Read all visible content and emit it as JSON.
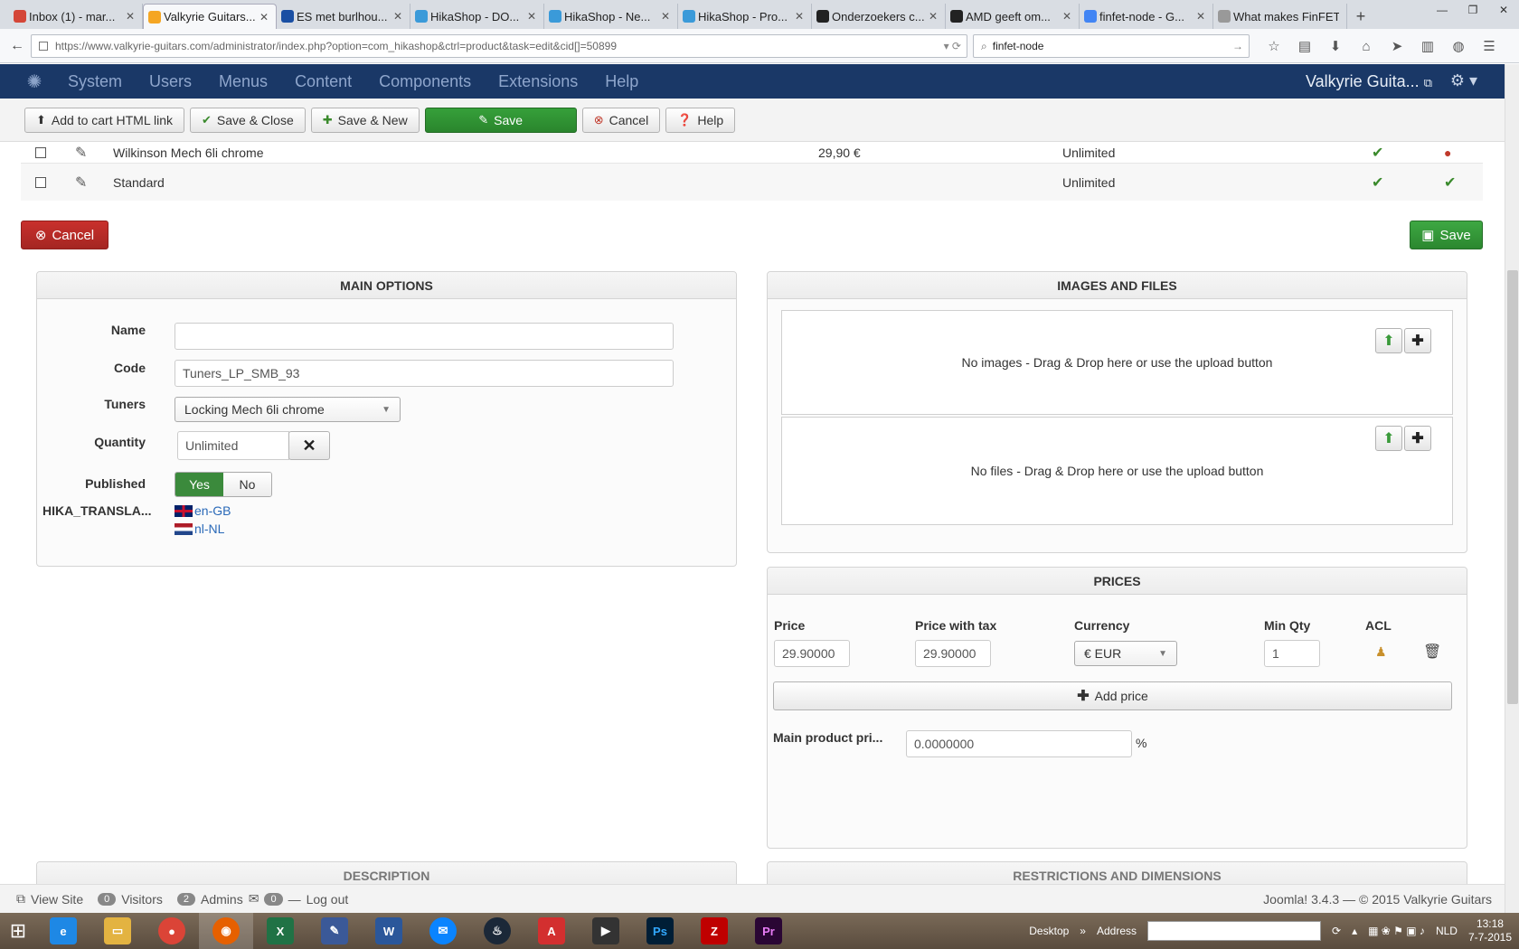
{
  "browser": {
    "tabs": [
      {
        "label": "Inbox (1) - mar...",
        "color": "#d44638",
        "active": false
      },
      {
        "label": "Valkyrie Guitars...",
        "color": "#f5a623",
        "active": true
      },
      {
        "label": "ES met burlhou...",
        "color": "#1a4fa3",
        "active": false
      },
      {
        "label": "HikaShop - DO...",
        "color": "#3a9ad9",
        "active": false
      },
      {
        "label": "HikaShop - Ne...",
        "color": "#3a9ad9",
        "active": false
      },
      {
        "label": "HikaShop - Pro...",
        "color": "#3a9ad9",
        "active": false
      },
      {
        "label": "Onderzoekers c...",
        "color": "#222222",
        "active": false
      },
      {
        "label": "AMD geeft om...",
        "color": "#222222",
        "active": false
      },
      {
        "label": "finfet-node - G...",
        "color": "#4285f4",
        "active": false
      },
      {
        "label": "What makes FinFET...",
        "color": "#999999",
        "active": false
      }
    ],
    "url": "https://www.valkyrie-guitars.com/administrator/index.php?option=com_hikashop&ctrl=product&task=edit&cid[]=50899",
    "search": "finfet-node"
  },
  "joomla": {
    "menu": [
      "System",
      "Users",
      "Menus",
      "Content",
      "Components",
      "Extensions",
      "Help"
    ],
    "site_name": "Valkyrie Guita..."
  },
  "toolbar": {
    "add_to_cart": "Add to cart HTML link",
    "save_close": "Save & Close",
    "save_new": "Save & New",
    "save": "Save",
    "cancel": "Cancel",
    "help": "Help"
  },
  "variants": {
    "partial_row": {
      "name": "Wilkinson Mech 6li chrome",
      "price": "29,90 €",
      "qty": "Unlimited"
    },
    "row": {
      "name": "Standard",
      "qty": "Unlimited"
    }
  },
  "actions": {
    "cancel": "Cancel",
    "save": "Save"
  },
  "main_options": {
    "title": "MAIN OPTIONS",
    "name_label": "Name",
    "name_value": "",
    "code_label": "Code",
    "code_value": "Tuners_LP_SMB_93",
    "tuners_label": "Tuners",
    "tuners_value": "Locking Mech 6li chrome",
    "quantity_label": "Quantity",
    "quantity_value": "Unlimited",
    "published_label": "Published",
    "published_yes": "Yes",
    "published_no": "No",
    "translations_label": "HIKA_TRANSLA...",
    "lang_en": "en-GB",
    "lang_nl": "nl-NL"
  },
  "images_files": {
    "title": "IMAGES AND FILES",
    "no_images": "No images - Drag & Drop here or use the upload button",
    "no_files": "No files - Drag & Drop here or use the upload button"
  },
  "prices": {
    "title": "PRICES",
    "col_price": "Price",
    "col_price_tax": "Price with tax",
    "col_currency": "Currency",
    "col_min_qty": "Min Qty",
    "col_acl": "ACL",
    "price": "29.90000",
    "price_with_tax": "29.90000",
    "currency": "€ EUR",
    "min_qty": "1",
    "add_price": "Add price",
    "main_product_label": "Main product pri...",
    "main_product_value": "0.0000000",
    "percent": "%"
  },
  "sections": {
    "description": "DESCRIPTION",
    "restrictions": "RESTRICTIONS AND DIMENSIONS"
  },
  "status": {
    "view_site": "View Site",
    "visitors_count": "0",
    "visitors": "Visitors",
    "admins_count": "2",
    "admins": "Admins",
    "messages_count": "0",
    "logout": "Log out",
    "footer": "Joomla! 3.4.3  —  © 2015 Valkyrie Guitars"
  },
  "taskbar": {
    "desktop": "Desktop",
    "address": "Address",
    "lang": "NLD",
    "time": "13:18",
    "date": "7-7-2015"
  }
}
